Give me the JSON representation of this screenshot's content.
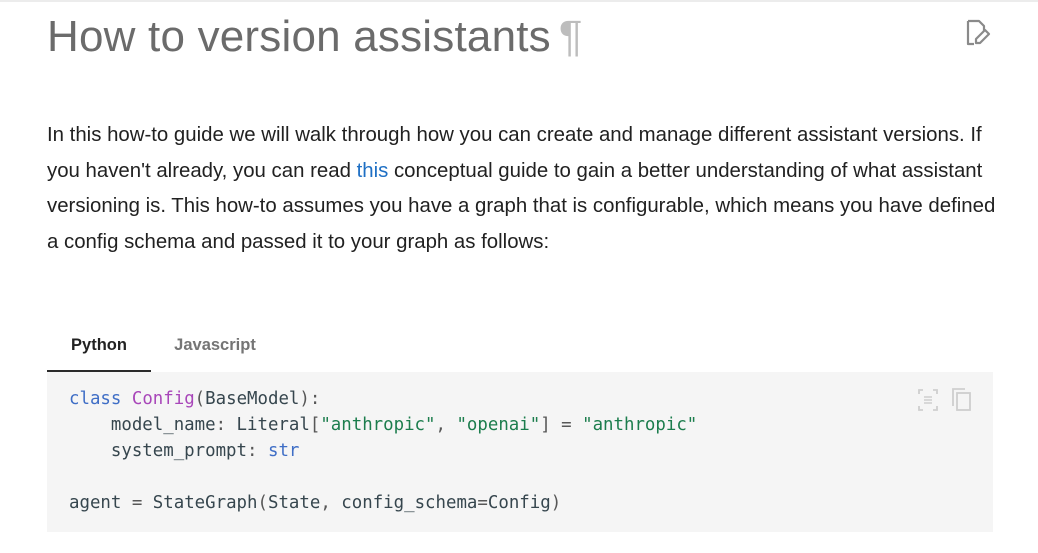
{
  "heading": {
    "title": "How to version assistants",
    "anchor_symbol": "¶",
    "edit_icon": "edit-page-icon"
  },
  "paragraph": {
    "before_link": "In this how-to guide we will walk through how you can create and manage different assistant versions. If you haven't already, you can read ",
    "link_text": "this",
    "after_link": " conceptual guide to gain a better understanding of what assistant versioning is. This how-to assumes you have a graph that is configurable, which means you have defined a config schema and passed it to your graph as follows:"
  },
  "tabs": [
    {
      "label": "Python",
      "active": true
    },
    {
      "label": "Javascript",
      "active": false
    }
  ],
  "code": {
    "icons": [
      "select-lines-icon",
      "copy-icon"
    ],
    "line1": {
      "k1": "class",
      "cls": "Config",
      "p1": "(",
      "base": "BaseModel",
      "p2": "):"
    },
    "line2": {
      "indent": "    ",
      "name": "model_name",
      "p1": ": ",
      "t": "Literal",
      "p2": "[",
      "s1": "\"anthropic\"",
      "p3": ", ",
      "s2": "\"openai\"",
      "p4": "] = ",
      "s3": "\"anthropic\""
    },
    "line3": {
      "indent": "    ",
      "name": "system_prompt",
      "p1": ": ",
      "t": "str"
    },
    "line5": {
      "var": "agent",
      "p1": " = ",
      "fn": "StateGraph",
      "p2": "(",
      "a1": "State",
      "p3": ", ",
      "kw": "config_schema",
      "p4": "=",
      "a2": "Config",
      "p5": ")"
    }
  },
  "colors": {
    "link": "#1e6fc4",
    "code_background": "#f5f5f5",
    "code_string": "#1c7d4d",
    "code_keyword": "#3f6ec6",
    "code_class": "#a846b9"
  }
}
